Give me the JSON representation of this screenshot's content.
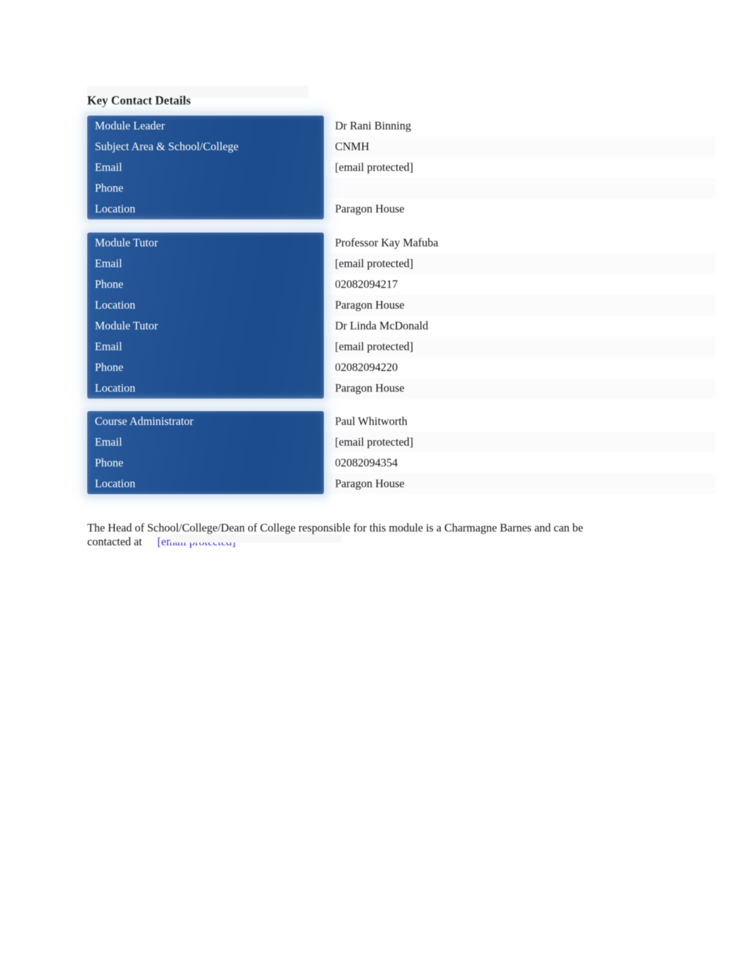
{
  "document": {
    "heading": "Key Contact Details",
    "closing_text": "The Head of School/College/Dean of College responsible for this module is a Charmagne Barnes and can be contacted at",
    "closing_link": "[email protected]"
  },
  "colors": {
    "panel_blue": "#1F5094",
    "panel_blue_light": "#2A5C9E",
    "link_blue": "#3334CC",
    "label_text": "#FFFFFF",
    "value_text": "#141414",
    "page_background": "#FFFFFF",
    "row_alt_background": "#FBFBFC"
  },
  "tables": [
    {
      "id": "module-leader",
      "rows": [
        {
          "label": "Module Leader",
          "value": "Dr Rani Binning"
        },
        {
          "label": "Subject Area & School/College",
          "value": "CNMH"
        },
        {
          "label": "Email",
          "value": "[email protected]"
        },
        {
          "label": "Phone",
          "value": ""
        },
        {
          "label": "Location",
          "value": "Paragon House"
        }
      ]
    },
    {
      "id": "module-tutors",
      "rows": [
        {
          "label": "Module Tutor",
          "value": "Professor Kay Mafuba"
        },
        {
          "label": "Email",
          "value": "[email protected]"
        },
        {
          "label": "Phone",
          "value": "02082094217"
        },
        {
          "label": "Location",
          "value": "Paragon House"
        },
        {
          "label": "Module Tutor",
          "value": "Dr Linda McDonald"
        },
        {
          "label": "Email",
          "value": "[email protected]"
        },
        {
          "label": "Phone",
          "value": "02082094220"
        },
        {
          "label": "Location",
          "value": "Paragon House"
        }
      ]
    },
    {
      "id": "course-administrator",
      "rows": [
        {
          "label": "Course Administrator",
          "value": "Paul Whitworth"
        },
        {
          "label": "Email",
          "value": "[email protected]"
        },
        {
          "label": "Phone",
          "value": "02082094354"
        },
        {
          "label": "Location",
          "value": "Paragon House"
        }
      ]
    }
  ]
}
